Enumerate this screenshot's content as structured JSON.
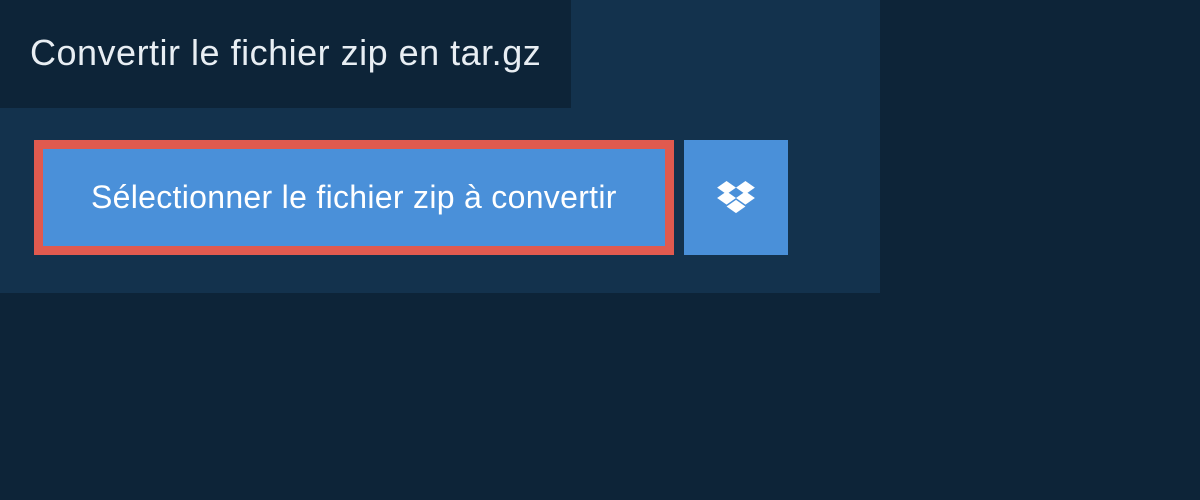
{
  "header": {
    "title": "Convertir le fichier zip en tar.gz"
  },
  "actions": {
    "select_file_label": "Sélectionner le fichier zip à convertir"
  },
  "colors": {
    "background": "#0d2438",
    "panel": "#13324d",
    "button": "#4a90d9",
    "highlight_border": "#e05a4f",
    "text_light": "#ffffff",
    "text_title": "#e8eef3"
  }
}
